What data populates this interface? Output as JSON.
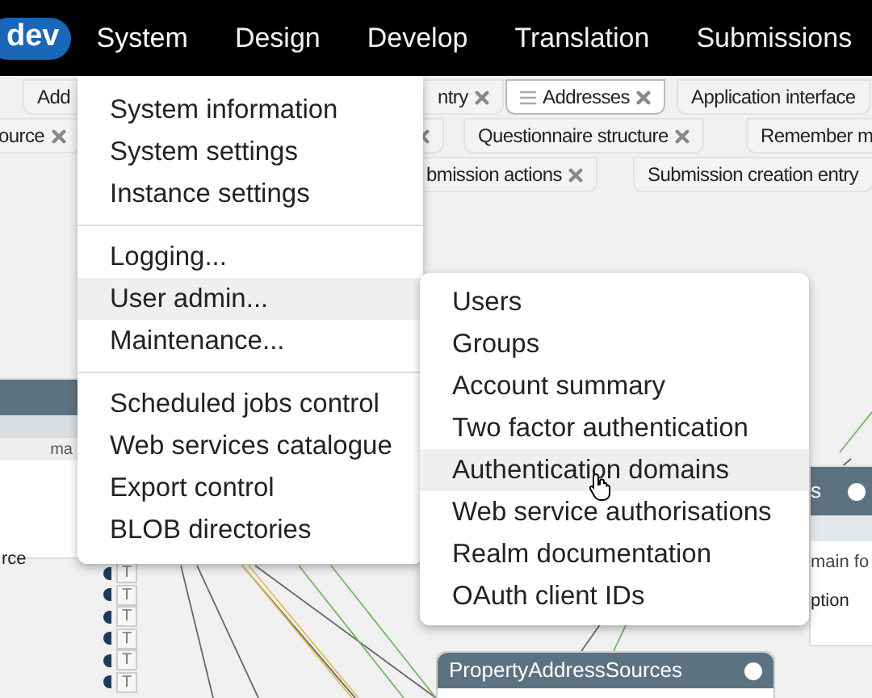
{
  "nav_bar": {
    "logo": "dev",
    "menus": [
      {
        "label": "System",
        "selected": true
      },
      {
        "label": "Design",
        "selected": false
      },
      {
        "label": "Develop",
        "selected": false
      },
      {
        "label": "Translation",
        "selected": false
      },
      {
        "label": "Submissions",
        "selected": false
      }
    ]
  },
  "tab_rows": [
    [
      {
        "label": "Add",
        "selected": false,
        "closable": false
      },
      {
        "label": "ntry",
        "selected": false,
        "closable": true
      },
      {
        "label": "Addresses",
        "selected": true,
        "closable": true
      },
      {
        "label": "Application interface",
        "selected": false,
        "closable": false
      }
    ],
    [
      {
        "label": "ource",
        "selected": false,
        "closable": true
      },
      {
        "selected": false,
        "closable": true
      },
      {
        "label": "Questionnaire structure",
        "selected": false,
        "closable": true
      },
      {
        "label": "Remember m",
        "selected": false
      }
    ],
    [
      {
        "label": "bmission actions",
        "selected": false,
        "closable": true
      },
      {
        "label": "Submission creation entry",
        "selected": false,
        "closable": false
      }
    ]
  ],
  "canvas": {
    "left_node": {
      "caption": "ma",
      "field": "rce",
      "type_markers": [
        "T",
        "T",
        "T",
        "T",
        "T",
        "T"
      ]
    },
    "right_node": {
      "title": "s",
      "caption": "main fo",
      "field": "ption"
    },
    "bottom_node": {
      "title": "PropertyAddressSources"
    }
  },
  "system_menu": {
    "groups": [
      [
        {
          "label": "System information",
          "selected": false
        },
        {
          "label": "System settings",
          "selected": false
        },
        {
          "label": "Instance settings",
          "selected": false
        }
      ],
      [
        {
          "label": "Logging...",
          "selected": false
        },
        {
          "label": "User admin...",
          "selected": true
        },
        {
          "label": "Maintenance...",
          "selected": false
        }
      ],
      [
        {
          "label": "Scheduled jobs control",
          "selected": false
        },
        {
          "label": "Web services catalogue",
          "selected": false
        },
        {
          "label": "Export control",
          "selected": false
        },
        {
          "label": "BLOB directories",
          "selected": false
        }
      ]
    ]
  },
  "user_admin_submenu": {
    "items": [
      {
        "label": "Users",
        "selected": false
      },
      {
        "label": "Groups",
        "selected": false
      },
      {
        "label": "Account summary",
        "selected": false
      },
      {
        "label": "Two factor authentication",
        "selected": false
      },
      {
        "label": "Authentication domains",
        "selected": true
      },
      {
        "label": "Web service authorisations",
        "selected": false
      },
      {
        "label": "Realm documentation",
        "selected": false
      },
      {
        "label": "OAuth client IDs",
        "selected": false
      }
    ]
  }
}
